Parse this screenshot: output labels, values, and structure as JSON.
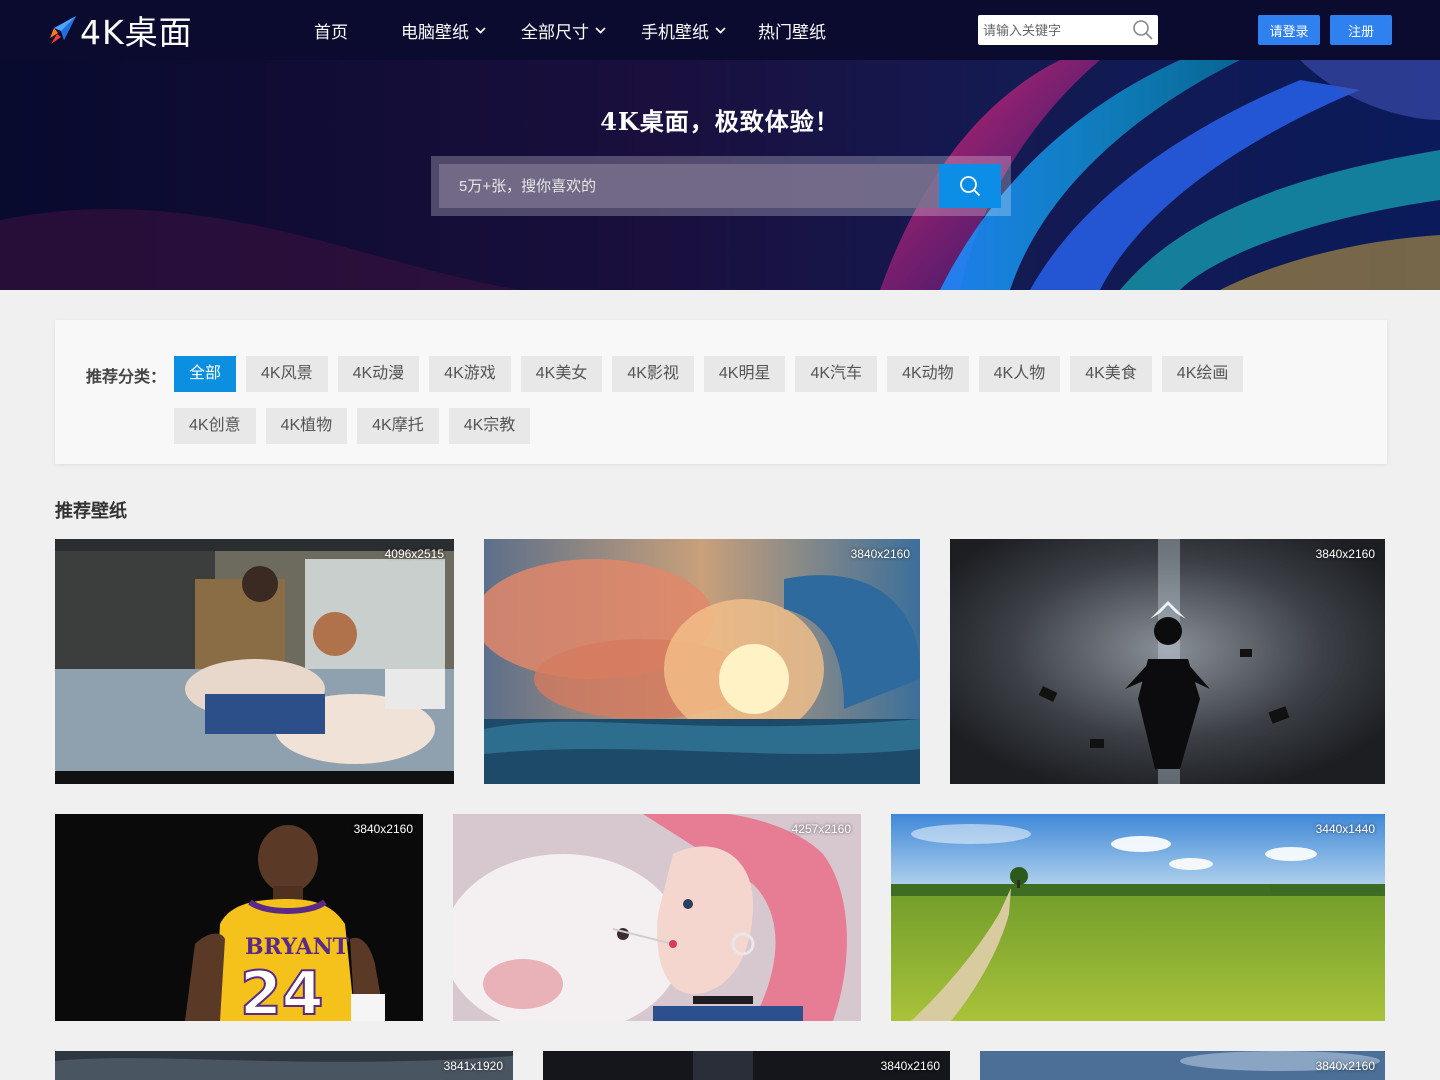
{
  "brand": {
    "name": "4K桌面"
  },
  "nav": {
    "home": "首页",
    "pc": "电脑壁纸",
    "sizes": "全部尺寸",
    "mobile": "手机壁纸",
    "hot": "热门壁纸"
  },
  "top_search": {
    "placeholder": "请输入关键字"
  },
  "auth": {
    "login": "请登录",
    "register": "注册"
  },
  "hero": {
    "title": "4K桌面，极致体验！",
    "placeholder": "5万+张，搜你喜欢的"
  },
  "categories": {
    "label": "推荐分类：",
    "items": [
      "全部",
      "4K风景",
      "4K动漫",
      "4K游戏",
      "4K美女",
      "4K影视",
      "4K明星",
      "4K汽车",
      "4K动物",
      "4K人物",
      "4K美食",
      "4K绘画",
      "4K创意",
      "4K植物",
      "4K摩托",
      "4K宗教"
    ],
    "active": "全部"
  },
  "section": {
    "title": "推荐壁纸"
  },
  "wallpapers": [
    {
      "resolution": "4096x2515"
    },
    {
      "resolution": "3840x2160"
    },
    {
      "resolution": "3840x2160"
    },
    {
      "resolution": "3840x2160"
    },
    {
      "resolution": "4257x2160"
    },
    {
      "resolution": "3440x1440"
    },
    {
      "resolution": "3841x1920"
    },
    {
      "resolution": "3840x2160"
    },
    {
      "resolution": "3840x2160"
    }
  ],
  "colors": {
    "nav_bg": "#0b0b30",
    "accent": "#0b8fe0",
    "button": "#2f81f0"
  }
}
